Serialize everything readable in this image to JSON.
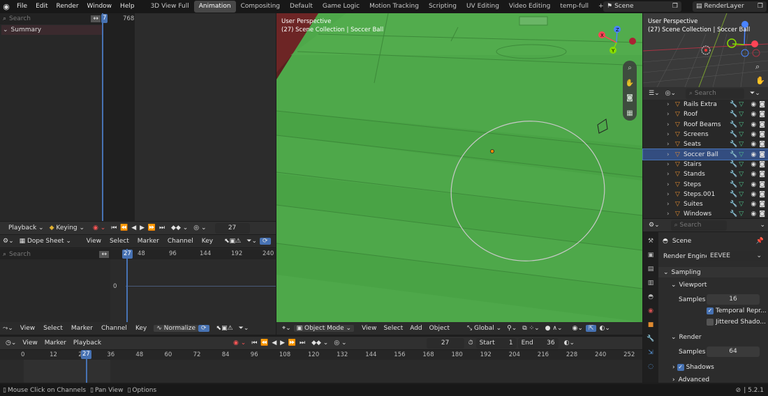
{
  "menu": [
    "File",
    "Edit",
    "Render",
    "Window",
    "Help"
  ],
  "workspaces": [
    "3D View Full",
    "Animation",
    "Compositing",
    "Default",
    "Game Logic",
    "Motion Tracking",
    "Scripting",
    "UV Editing",
    "Video Editing",
    "temp-full"
  ],
  "add_tab": "+",
  "scene": "Scene",
  "view_layer": "RenderLayer",
  "channels": {
    "search_placeholder": "Search",
    "summary": "Summary",
    "frame_indicator": "7",
    "ruler_end": "768"
  },
  "playback_hdr": {
    "playback": "Playback",
    "keying": "Keying",
    "frame": "27"
  },
  "dopesheet": {
    "mode": "Dope Sheet",
    "menus": [
      "View",
      "Select",
      "Marker",
      "Channel",
      "Key"
    ],
    "search_placeholder": "Search",
    "frame": "27",
    "ticks": [
      "48",
      "96",
      "144",
      "192",
      "240"
    ],
    "zero": "0",
    "footer_menus": [
      "View",
      "Select",
      "Marker",
      "Channel",
      "Key"
    ],
    "normalize": "Normalize"
  },
  "timeline": {
    "menus": [
      "View",
      "Marker",
      "Playback"
    ],
    "frame": "27",
    "start_label": "Start",
    "start": "1",
    "end_label": "End",
    "end": "36",
    "ticks": [
      "0",
      "12",
      "24",
      "36",
      "48",
      "60",
      "72",
      "84",
      "96",
      "108",
      "120",
      "132",
      "144",
      "156",
      "168",
      "180",
      "192",
      "204",
      "216",
      "228",
      "240",
      "252"
    ]
  },
  "viewport": {
    "perspective": "User Perspective",
    "collection": "(27) Scene Collection | Soccer Ball",
    "mode": "Object Mode",
    "menus": [
      "View",
      "Select",
      "Add",
      "Object"
    ],
    "orientation": "Global"
  },
  "mini_viewport": {
    "perspective": "User Perspective",
    "collection": "(27) Scene Collection | Soccer Ball"
  },
  "outliner": {
    "search_placeholder": "Search",
    "items": [
      "Rails Extra",
      "Roof",
      "Roof Beams",
      "Screens",
      "Seats",
      "Soccer Ball",
      "Stairs",
      "Stands",
      "Steps",
      "Steps.001",
      "Suites",
      "Windows"
    ],
    "selected": "Soccer Ball"
  },
  "properties": {
    "search_placeholder": "Search",
    "scene": "Scene",
    "render_engine_label": "Render Engine",
    "render_engine": "EEVEE",
    "sampling": "Sampling",
    "viewport": "Viewport",
    "samples_label": "Samples",
    "viewport_samples": "16",
    "temporal": "Temporal Repr...",
    "jittered": "Jittered Shado...",
    "render": "Render",
    "render_samples": "64",
    "shadows": "Shadows",
    "advanced": "Advanced"
  },
  "status": {
    "left1": "Mouse Click on Channels",
    "left2": "Pan View",
    "left3": "Options",
    "version": "5.2.1"
  },
  "colors": {
    "accent": "#4772b3",
    "field_green": "#4ea84a",
    "bg": "#1d1d1d"
  }
}
